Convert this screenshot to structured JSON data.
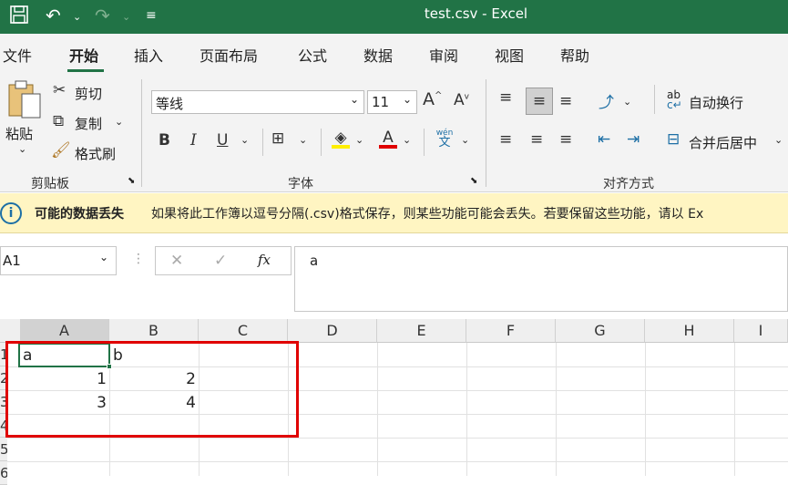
{
  "window": {
    "title": "test.csv  -  Excel"
  },
  "tabs": [
    "文件",
    "开始",
    "插入",
    "页面布局",
    "公式",
    "数据",
    "审阅",
    "视图",
    "帮助"
  ],
  "clipboard": {
    "paste": "粘贴",
    "cut": "剪切",
    "copy": "复制",
    "format_painter": "格式刷",
    "group": "剪贴板"
  },
  "font": {
    "name": "等线",
    "size": "11",
    "group": "字体",
    "bold": "B",
    "italic": "I",
    "underline": "U",
    "grow": "A",
    "shrink": "A",
    "phonetic_top": "wén",
    "phonetic_bottom": "文"
  },
  "alignment": {
    "wrap": "自动换行",
    "merge": "合并后居中",
    "group": "对齐方式"
  },
  "infobar": {
    "title": "可能的数据丢失",
    "message": "如果将此工作簿以逗号分隔(.csv)格式保存，则某些功能可能会丢失。若要保留这些功能，请以 Ex"
  },
  "formula_bar": {
    "name_box": "A1",
    "fx": "fx",
    "value": "a"
  },
  "grid": {
    "columns": [
      "A",
      "B",
      "C",
      "D",
      "E",
      "F",
      "G",
      "H",
      "I"
    ],
    "rows": [
      "1",
      "2",
      "3",
      "4",
      "5",
      "6"
    ],
    "cells": {
      "A1": "a",
      "B1": "b",
      "A2": "1",
      "B2": "2",
      "A3": "3",
      "B3": "4"
    }
  },
  "colors": {
    "titlebar": "#217346",
    "highlight": "#e00000"
  }
}
